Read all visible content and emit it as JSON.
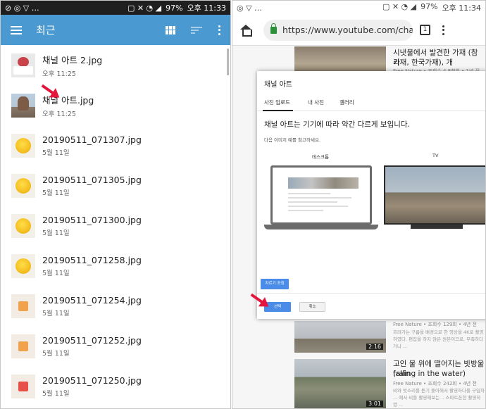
{
  "left": {
    "status": {
      "mute": "⊘",
      "signal_text": "● ..",
      "battery": "97%",
      "time": "오후 11:33"
    },
    "appbar_title": "최근",
    "files": [
      {
        "name": "채널 아트 2.jpg",
        "date": "오후 11:25",
        "thumb": "flower"
      },
      {
        "name": "채널 아트.jpg",
        "date": "오후 11:25",
        "thumb": "tree"
      },
      {
        "name": "20190511_071307.jpg",
        "date": "5월 11일",
        "thumb": "yolk"
      },
      {
        "name": "20190511_071305.jpg",
        "date": "5월 11일",
        "thumb": "yolk"
      },
      {
        "name": "20190511_071300.jpg",
        "date": "5월 11일",
        "thumb": "yolk"
      },
      {
        "name": "20190511_071258.jpg",
        "date": "5월 11일",
        "thumb": "yolk"
      },
      {
        "name": "20190511_071254.jpg",
        "date": "5월 11일",
        "thumb": "image"
      },
      {
        "name": "20190511_071252.jpg",
        "date": "5월 11일",
        "thumb": "image"
      },
      {
        "name": "20190511_071250.jpg",
        "date": "5월 11일",
        "thumb": "image-red"
      }
    ]
  },
  "right": {
    "status": {
      "battery": "97%",
      "time": "오후 11:34"
    },
    "url_scheme_host": "https://www.youtube.com/cha",
    "tab_count": "1",
    "bg_videos": [
      {
        "title": "시냇물에서 발견한 가재 (참가재, 한국가재), 개",
        "title2": "리",
        "meta": "Free Nature • 조회수 4.8천회 • 1년 전"
      },
      {
        "title": "",
        "meta": "Free Nature • 조회수 129회 • 4년 전",
        "desc": "흐려가는 구름을 배경으로 한 영상을 4K로 촬영하였다. 편집을 하지 않은 원본이므로, 부족하다거나 ...",
        "duration": "2:16"
      },
      {
        "title": "고인 물 위에 떨어지는 빗방울 (rain",
        "title2": "falling in the water)",
        "meta": "Free Nature • 조회수 242회 • 4년 전",
        "desc": "비와 빗소리를 듣기 좋아해서 촬영하다를 구입하 ... 에서 비를 촬영해보는 .. 스마트폰한 촬영하였 ...",
        "duration": "3:01"
      }
    ],
    "dialog": {
      "title": "채널 아트",
      "tabs": [
        "사진 업로드",
        "내 사진",
        "갤러리"
      ],
      "heading": "채널 아트는 기기에 따라 약간 다르게 보입니다.",
      "sub": "다음 이미지 예를 참고하세요.",
      "label_desktop": "데스크톱",
      "label_tv": "TV",
      "crop_button": "자르기 조정",
      "select_button": "선택",
      "cancel_button": "취소"
    }
  },
  "colors": {
    "appbar": "#4a9ad1",
    "accent_blue": "#4a8ce8",
    "arrow": "#e5163d"
  }
}
